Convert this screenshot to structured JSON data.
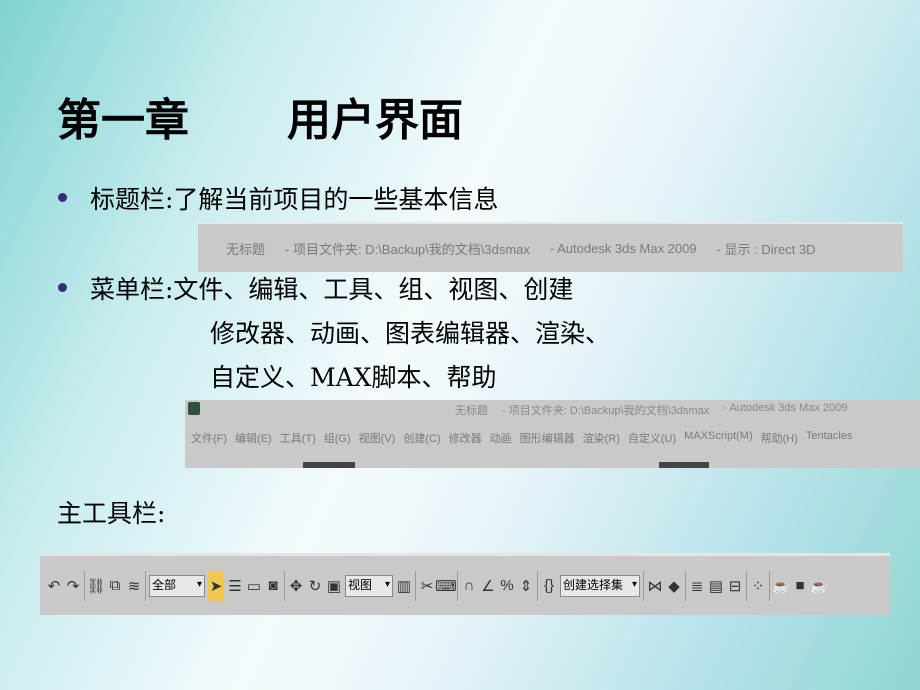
{
  "slide": {
    "title_chapter": "第一章",
    "title_name": "用户界面",
    "bullet1": "标题栏:了解当前项目的一些基本信息",
    "bullet2_line1": "菜单栏:文件、编辑、工具、组、视图、创建",
    "bullet2_line2": "修改器、动画、图表编辑器、渲染、",
    "bullet2_line3": "自定义、MAX脚本、帮助",
    "toolbar_heading": "主工具栏:"
  },
  "titlebar": {
    "parts": [
      "无标题",
      "- 项目文件夹: D:\\Backup\\我的文档\\3dsmax",
      "- Autodesk 3ds Max  2009",
      "- 显示 : Direct 3D"
    ]
  },
  "menubar": {
    "title_parts": [
      "无标题",
      "- 项目文件夹: D:\\Backup\\我的文档\\3dsmax",
      "- Autodesk 3ds Max  2009"
    ],
    "items": [
      "文件(F)",
      "编辑(E)",
      "工具(T)",
      "组(G)",
      "视图(V)",
      "创建(C)",
      "修改器",
      "动画",
      "图形编辑器",
      "渲染(R)",
      "自定义(U)",
      "MAXScript(M)",
      "帮助(H)",
      "Tentacles"
    ]
  },
  "toolbar": {
    "filter_select": "全部",
    "coord_select": "视图",
    "selection_set": "创建选择集",
    "icons": [
      "undo",
      "redo",
      "link",
      "unlink",
      "bind-space-warp",
      "select",
      "select-by-name",
      "rect-region",
      "window-crossing",
      "move",
      "rotate",
      "scale",
      "use-pivot",
      "manipulate",
      "keyboard-shortcut",
      "snap-3d",
      "angle-snap",
      "percent-snap",
      "spinner-snap",
      "edit-named-sets",
      "mirror",
      "align",
      "layer-manager",
      "curve-editor",
      "schematic-view",
      "material-editor",
      "render-setup",
      "rendered-frame",
      "quick-render"
    ]
  }
}
